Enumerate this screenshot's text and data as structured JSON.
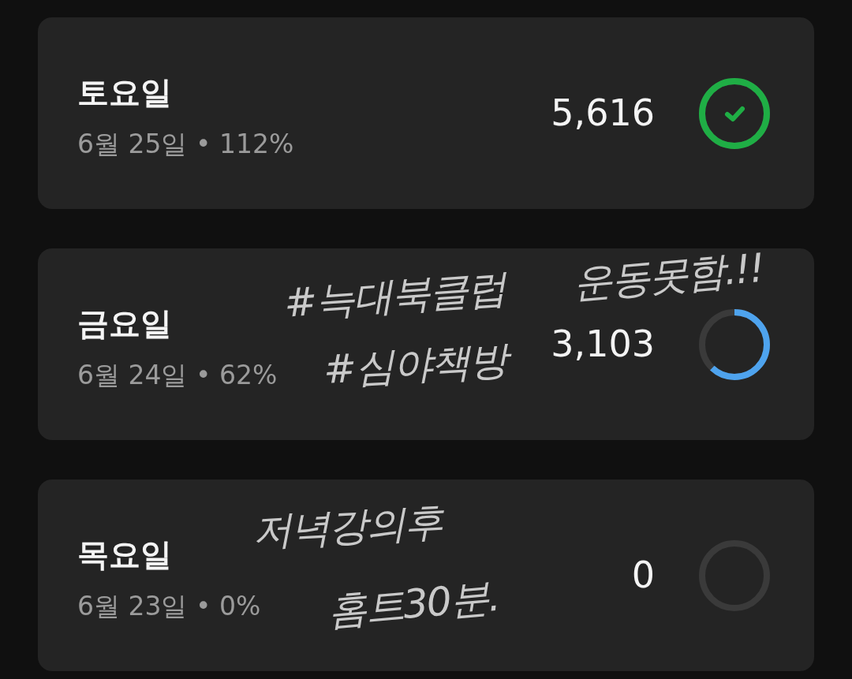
{
  "days": [
    {
      "title": "토요일",
      "summary": "6월 25일 • 112%",
      "steps": "5,616",
      "kind": "done"
    },
    {
      "title": "금요일",
      "summary": "6월 24일 • 62%",
      "steps": "3,103",
      "kind": "partial",
      "notes": [
        "#늑대북클럽",
        "#심야책방",
        "운동못함.!!"
      ]
    },
    {
      "title": "목요일",
      "summary": "6월 23일 • 0%",
      "steps": "0",
      "kind": "empty",
      "notes": [
        "저녁강의후",
        "홈트30분."
      ]
    }
  ]
}
